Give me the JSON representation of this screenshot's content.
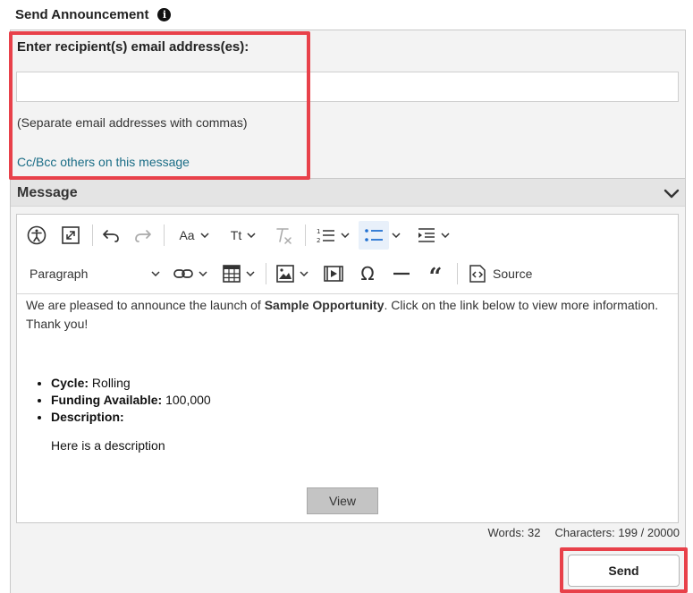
{
  "header": {
    "title": "Send Announcement",
    "info_icon": "info-icon"
  },
  "recipient": {
    "label": "Enter recipient(s) email address(es):",
    "value": "",
    "helper": "(Separate email addresses with commas)",
    "cc_link": "Cc/Bcc others on this message"
  },
  "message_section": {
    "label": "Message",
    "toggle_icon": "chevron-down-icon"
  },
  "toolbar": {
    "row1_icons": [
      "accessibility-icon",
      "fullscreen-icon",
      "undo-icon",
      "redo-icon",
      "font-family-icon",
      "font-size-icon",
      "remove-format-icon",
      "numbered-list-icon",
      "bulleted-list-icon",
      "indent-icon"
    ],
    "font_family_glyph": "Aa",
    "font_size_glyph": "Tt",
    "paragraph_label": "Paragraph",
    "row2_icons": [
      "link-icon",
      "table-icon",
      "image-icon",
      "media-icon",
      "special-character-icon",
      "horizontal-line-icon",
      "blockquote-icon",
      "source-icon"
    ],
    "source_label": "Source"
  },
  "content": {
    "intro_before": "We are pleased to announce the launch of ",
    "intro_bold": "Sample Opportunity",
    "intro_after": ". Click on the link below to view more information. Thank you!",
    "items": [
      {
        "label": "Cycle:",
        "value": " Rolling"
      },
      {
        "label": "Funding Available:",
        "value": " 100,000"
      },
      {
        "label": "Description:",
        "value": ""
      }
    ],
    "description_text": "Here is a description",
    "view_button": "View"
  },
  "counts": {
    "words": "Words: 32",
    "characters": "Characters: 199 / 20000"
  },
  "actions": {
    "send_label": "Send"
  },
  "colors": {
    "highlight": "#e8414a",
    "link": "#1a6d86",
    "active_tool": "#e8f0fa"
  }
}
